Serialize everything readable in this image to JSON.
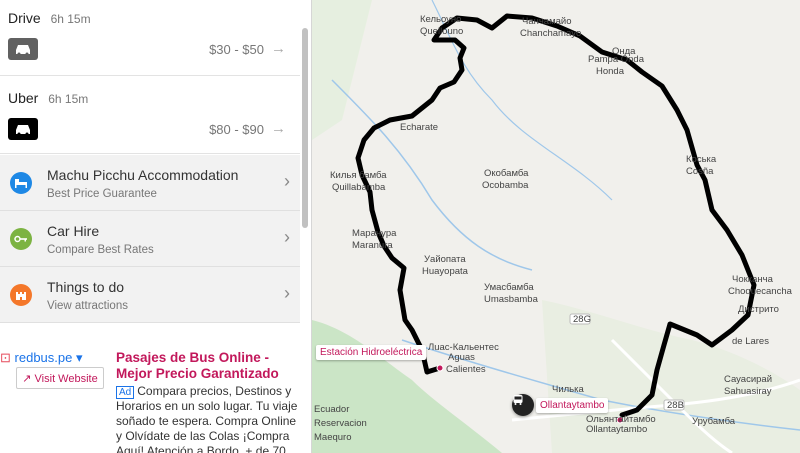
{
  "routes": [
    {
      "mode": "Drive",
      "duration": "6h 15m",
      "price": "$30 - $50",
      "icon": "car-icon",
      "badge_color": "#616161"
    },
    {
      "mode": "Uber",
      "duration": "6h 15m",
      "price": "$80 - $90",
      "icon": "car-icon",
      "badge_color": "#000000"
    }
  ],
  "services": [
    {
      "title": "Machu Picchu Accommodation",
      "subtitle": "Best Price Guarantee",
      "icon": "bed-icon",
      "color": "#1e88e5"
    },
    {
      "title": "Car Hire",
      "subtitle": "Compare Best Rates",
      "icon": "key-icon",
      "color": "#7cb342"
    },
    {
      "title": "Things to do",
      "subtitle": "View attractions",
      "icon": "castle-icon",
      "color": "#f4772a"
    }
  ],
  "ad": {
    "brand": "redbus.pe ▾",
    "visit_label": "↗ Visit Website",
    "tag": "Ad",
    "headline": "Pasajes de Bus Online - Mejor Precio Garantizado",
    "body": "Compara precios, Destinos y Horarios en un solo lugar. Tu viaje soñado te espera. Compra Online y Olvídate de las Colas ¡Compra Aquí! Atención a Bordo. + de 70"
  },
  "map": {
    "markers": [
      {
        "label": "Estación Hidroeléctrica",
        "icon": "pin-icon"
      },
      {
        "label": "Ollantaytambo",
        "icon": "bus-icon"
      }
    ],
    "places": [
      "Кельоуно",
      "Quellouno",
      "Чанчамайо",
      "Chanchamayo",
      "Онда",
      "Pampa Onda",
      "Honda",
      "Echarate",
      "Килья бамба",
      "Quillabamba",
      "Окобамба",
      "Ocobamba",
      "Коська",
      "Cosña",
      "Марануpa",
      "Maranura",
      "Уайопата",
      "Huayopata",
      "Умасбамба",
      "Umasbamba",
      "Лuac-Кальентес",
      "Aguas",
      "Calientes",
      "Чокканча",
      "Choquecancha",
      "Дистрито",
      "de Lares",
      "Чилька",
      "Ольянтайтамбо",
      "Ollantaytambo",
      "Сауасирай",
      "Sahuasiray",
      "Урубамба",
      "Ecuador",
      "Reservacion",
      "Maequro"
    ],
    "road_labels": [
      "28G",
      "28B"
    ],
    "colors": {
      "route": "#000000",
      "land": "#f1f0ec",
      "green": "#c7e3c2",
      "water": "#9fc7ea",
      "road": "#ffffff",
      "label": "#555555"
    }
  }
}
